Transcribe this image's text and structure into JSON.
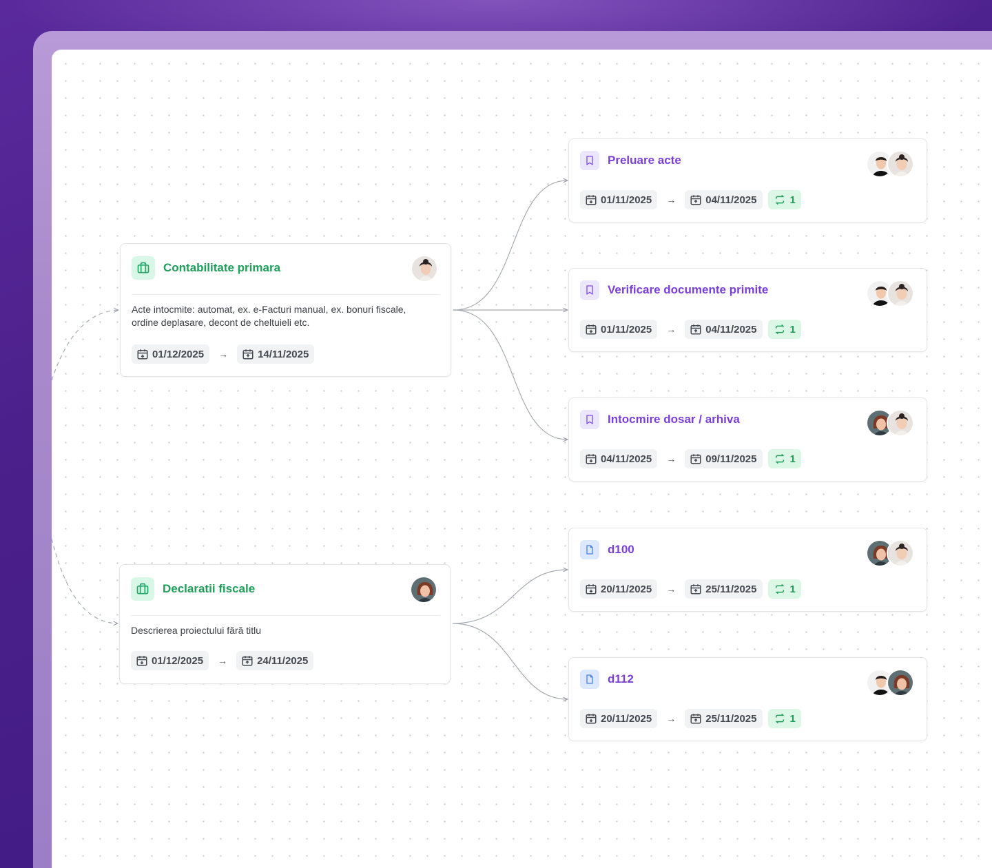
{
  "colors": {
    "parent_accent": "#1f9e5a",
    "child_accent": "#7a3fd9",
    "repeat_bg": "#dcf7e6"
  },
  "parents": [
    {
      "title": "Contabilitate primara",
      "icon": "briefcase-icon",
      "description": "Acte intocmite: automat, ex. e-Facturi manual, ex. bonuri fiscale, ordine deplasare, decont de cheltuieli etc.",
      "start": "01/12/2025",
      "end": "14/11/2025",
      "arrow": "→"
    },
    {
      "title": "Declaratii fiscale",
      "icon": "briefcase-icon",
      "description": "Descrierea proiectului fără titlu",
      "start": "01/12/2025",
      "end": "24/11/2025",
      "arrow": "→"
    }
  ],
  "tasks": [
    {
      "title": "Preluare acte",
      "icon": "bookmark-icon",
      "start": "01/11/2025",
      "end": "04/11/2025",
      "arrow": "→",
      "repeat": "1"
    },
    {
      "title": "Verificare documente primite",
      "icon": "bookmark-icon",
      "start": "01/11/2025",
      "end": "04/11/2025",
      "arrow": "→",
      "repeat": "1"
    },
    {
      "title": "Intocmire dosar / arhiva",
      "icon": "bookmark-icon",
      "start": "04/11/2025",
      "end": "09/11/2025",
      "arrow": "→",
      "repeat": "1"
    },
    {
      "title": "d100",
      "icon": "document-icon",
      "start": "20/11/2025",
      "end": "25/11/2025",
      "arrow": "→",
      "repeat": "1"
    },
    {
      "title": "d112",
      "icon": "document-icon",
      "start": "20/11/2025",
      "end": "25/11/2025",
      "arrow": "→",
      "repeat": "1"
    }
  ]
}
